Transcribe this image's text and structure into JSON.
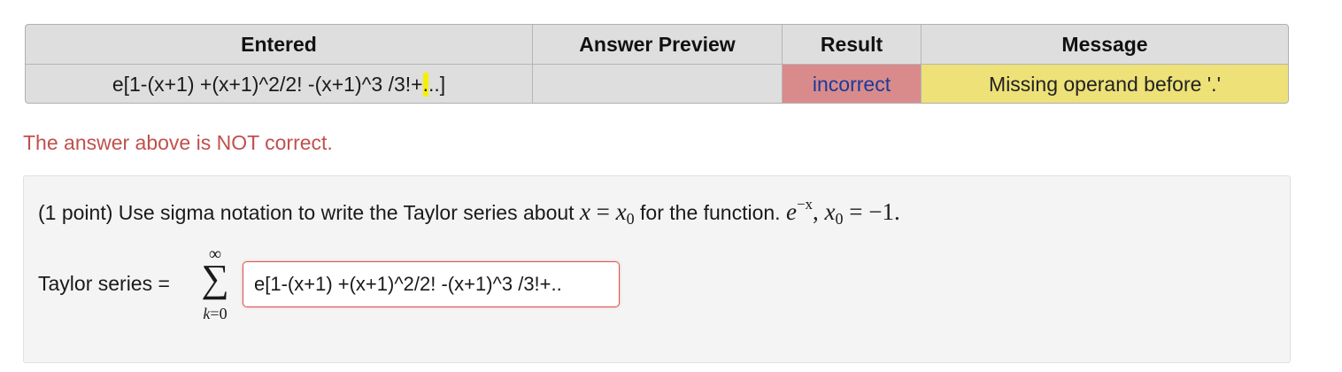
{
  "results": {
    "headers": {
      "entered": "Entered",
      "preview": "Answer Preview",
      "result": "Result",
      "message": "Message"
    },
    "row": {
      "entered_before": "e[1-(x+1) +(x+1)^2/2! -(x+1)^3 /3!+",
      "entered_highlight": ".",
      "entered_after": "..]",
      "preview": "",
      "result": "incorrect",
      "message": "Missing operand before '.'"
    },
    "colors": {
      "incorrect_bg": "#d98b8b",
      "message_bg": "#ede178",
      "highlight": "#f5f000"
    }
  },
  "status": {
    "text": "The answer above is NOT correct.",
    "color": "#c0504d"
  },
  "problem": {
    "points": "(1 point)",
    "text_before": " Use sigma notation to write the Taylor series about ",
    "var_x": "x",
    "eq": " = ",
    "x0_base": "x",
    "x0_sub": "0",
    "text_middle": " for the function. ",
    "func_base": "e",
    "func_exp": "−x",
    "comma": ",  ",
    "x0_again_base": "x",
    "x0_again_sub": "0",
    "x0_value": " = −1.",
    "taylor_label": "Taylor series =",
    "sigma_upper": "∞",
    "sigma_symbol": "∑",
    "sigma_lower_var": "k",
    "sigma_lower_rest": "=0",
    "answer_value": "e[1-(x+1) +(x+1)^2/2! -(x+1)^3 /3!+.."
  }
}
